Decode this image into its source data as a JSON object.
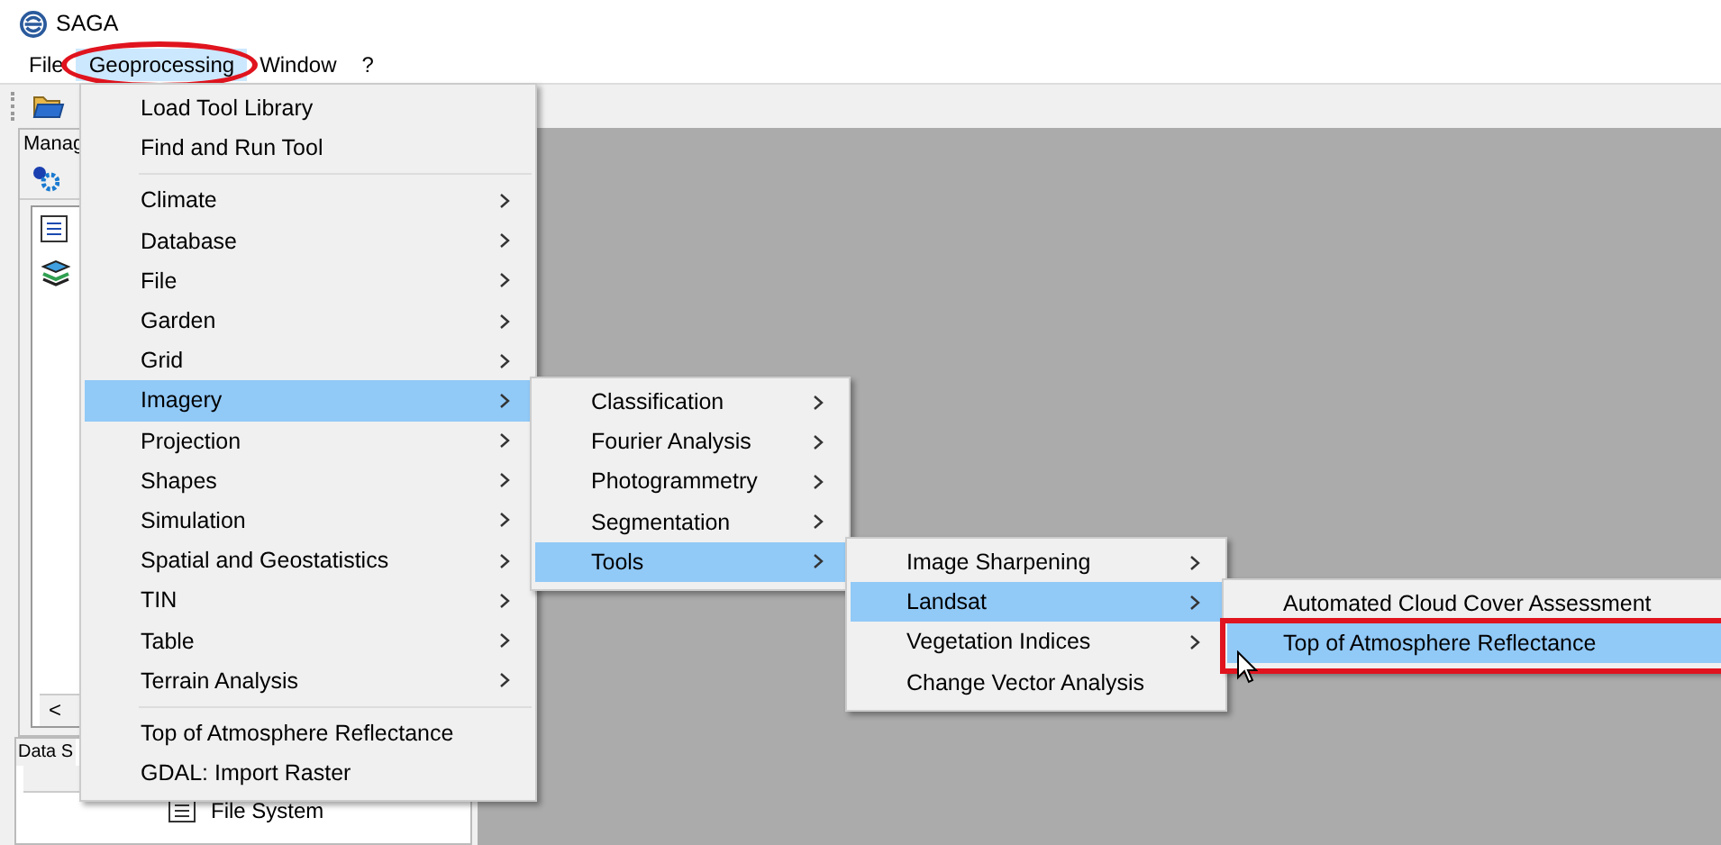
{
  "window": {
    "title": "SAGA"
  },
  "menubar": [
    {
      "label": "File",
      "selected": false,
      "highlighted": false
    },
    {
      "label": "Geoprocessing",
      "selected": true,
      "highlighted": true
    },
    {
      "label": "Window",
      "selected": false,
      "highlighted": false
    },
    {
      "label": "?",
      "selected": false,
      "highlighted": false
    }
  ],
  "manager_panel": {
    "title": "Manag",
    "scroll_left": "<"
  },
  "data_source_panel": {
    "title": "Data S",
    "item": "File System"
  },
  "menus": [
    {
      "items": [
        {
          "kind": "item",
          "label": "Load Tool Library",
          "submenu": false,
          "selected": false,
          "highlighted": false
        },
        {
          "kind": "item",
          "label": "Find and Run Tool",
          "submenu": false,
          "selected": false,
          "highlighted": false
        },
        {
          "kind": "separator"
        },
        {
          "kind": "item",
          "label": "Climate",
          "submenu": true,
          "selected": false,
          "highlighted": false
        },
        {
          "kind": "item",
          "label": "Database",
          "submenu": true,
          "selected": false,
          "highlighted": false
        },
        {
          "kind": "item",
          "label": "File",
          "submenu": true,
          "selected": false,
          "highlighted": false
        },
        {
          "kind": "item",
          "label": "Garden",
          "submenu": true,
          "selected": false,
          "highlighted": false
        },
        {
          "kind": "item",
          "label": "Grid",
          "submenu": true,
          "selected": false,
          "highlighted": false
        },
        {
          "kind": "item",
          "label": "Imagery",
          "submenu": true,
          "selected": true,
          "highlighted": false
        },
        {
          "kind": "item",
          "label": "Projection",
          "submenu": true,
          "selected": false,
          "highlighted": false
        },
        {
          "kind": "item",
          "label": "Shapes",
          "submenu": true,
          "selected": false,
          "highlighted": false
        },
        {
          "kind": "item",
          "label": "Simulation",
          "submenu": true,
          "selected": false,
          "highlighted": false
        },
        {
          "kind": "item",
          "label": "Spatial and Geostatistics",
          "submenu": true,
          "selected": false,
          "highlighted": false
        },
        {
          "kind": "item",
          "label": "TIN",
          "submenu": true,
          "selected": false,
          "highlighted": false
        },
        {
          "kind": "item",
          "label": "Table",
          "submenu": true,
          "selected": false,
          "highlighted": false
        },
        {
          "kind": "item",
          "label": "Terrain Analysis",
          "submenu": true,
          "selected": false,
          "highlighted": false
        },
        {
          "kind": "separator"
        },
        {
          "kind": "item",
          "label": "Top of Atmosphere Reflectance",
          "submenu": false,
          "selected": false,
          "highlighted": false
        },
        {
          "kind": "item",
          "label": "GDAL: Import Raster",
          "submenu": false,
          "selected": false,
          "highlighted": false
        }
      ]
    },
    {
      "items": [
        {
          "kind": "item",
          "label": "Classification",
          "submenu": true,
          "selected": false,
          "highlighted": false
        },
        {
          "kind": "item",
          "label": "Fourier Analysis",
          "submenu": true,
          "selected": false,
          "highlighted": false
        },
        {
          "kind": "item",
          "label": "Photogrammetry",
          "submenu": true,
          "selected": false,
          "highlighted": false
        },
        {
          "kind": "item",
          "label": "Segmentation",
          "submenu": true,
          "selected": false,
          "highlighted": false
        },
        {
          "kind": "item",
          "label": "Tools",
          "submenu": true,
          "selected": true,
          "highlighted": false
        }
      ]
    },
    {
      "items": [
        {
          "kind": "item",
          "label": "Image Sharpening",
          "submenu": true,
          "selected": false,
          "highlighted": false
        },
        {
          "kind": "item",
          "label": "Landsat",
          "submenu": true,
          "selected": true,
          "highlighted": false
        },
        {
          "kind": "item",
          "label": "Vegetation Indices",
          "submenu": true,
          "selected": false,
          "highlighted": false
        },
        {
          "kind": "item",
          "label": "Change Vector Analysis",
          "submenu": false,
          "selected": false,
          "highlighted": false
        }
      ]
    },
    {
      "items": [
        {
          "kind": "item",
          "label": "Automated Cloud Cover Assessment",
          "submenu": false,
          "selected": false,
          "highlighted": false
        },
        {
          "kind": "item",
          "label": "Top of Atmosphere Reflectance",
          "submenu": false,
          "selected": true,
          "highlighted": true
        }
      ]
    }
  ]
}
